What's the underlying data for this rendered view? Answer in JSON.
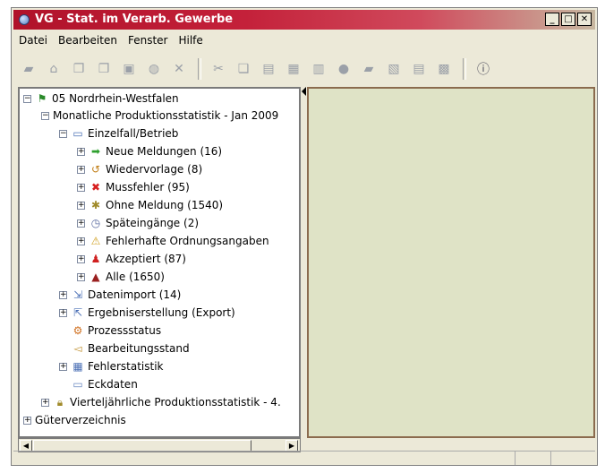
{
  "window": {
    "title": "VG - Stat. im Verarb. Gewerbe"
  },
  "title_buttons": {
    "minimize": "_",
    "maximize": "□",
    "close": "✕"
  },
  "menu": [
    {
      "label": "Datei"
    },
    {
      "label": "Bearbeiten"
    },
    {
      "label": "Fenster"
    },
    {
      "label": "Hilfe"
    }
  ],
  "toolbar": {
    "icons": [
      "open-icon",
      "home-icon",
      "copy-icon",
      "paste-icon",
      "save-icon",
      "refresh-icon",
      "close-icon",
      "cut-icon",
      "copy2-icon",
      "print-icon",
      "table-icon",
      "grid-icon",
      "globe-icon",
      "folder-icon",
      "chart-icon",
      "list-icon",
      "report-icon",
      "info-icon"
    ]
  },
  "tree": {
    "root": "05 Nordrhein-Westfalen",
    "monthly": "Monatliche Produktionsstatistik - Jan 2009",
    "einzelfall": "Einzelfall/Betrieb",
    "items": [
      {
        "label": "Neue Meldungen (16)"
      },
      {
        "label": "Wiedervorlage (8)"
      },
      {
        "label": "Mussfehler (95)"
      },
      {
        "label": "Ohne Meldung (1540)"
      },
      {
        "label": "Späteingänge (2)"
      },
      {
        "label": "Fehlerhafte Ordnungsangaben"
      },
      {
        "label": "Akzeptiert (87)"
      },
      {
        "label": "Alle (1650)"
      }
    ],
    "datenimport": "Datenimport  (14)",
    "ergebnis": "Ergebniserstellung (Export)",
    "prozess": "Prozessstatus",
    "bearbeitung": "Bearbeitungsstand",
    "fehlerstat": "Fehlerstatistik",
    "eckdaten": "Eckdaten",
    "quarterly": "Vierteljährliche Produktionsstatistik - 4.",
    "gueter": "Güterverzeichnis"
  },
  "colors": {
    "titlebar": "#b0122a",
    "right_panel": "#dfe3c6"
  }
}
